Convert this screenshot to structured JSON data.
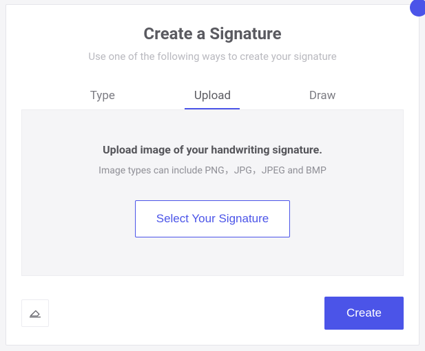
{
  "header": {
    "title": "Create a Signature",
    "subtitle": "Use one of the following ways to create your signature"
  },
  "tabs": {
    "type": "Type",
    "upload": "Upload",
    "draw": "Draw",
    "active": "Upload"
  },
  "uploadPanel": {
    "heading": "Upload image of your handwriting signature.",
    "hint": "Image types can include PNG，JPG，JPEG and BMP",
    "selectButton": "Select Your Signature"
  },
  "footer": {
    "createButton": "Create"
  }
}
